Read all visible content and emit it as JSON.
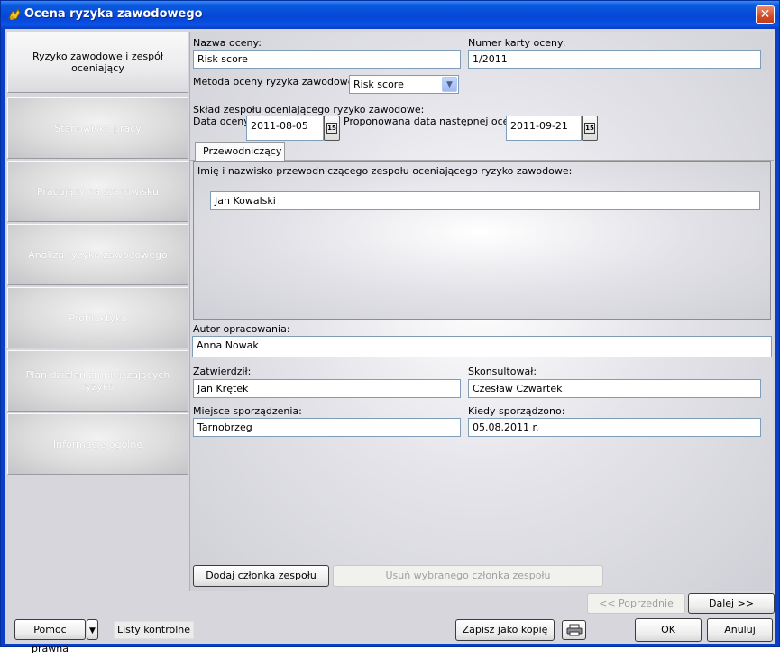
{
  "window": {
    "title": "Ocena ryzyka zawodowego"
  },
  "nav": {
    "items": [
      {
        "label": "Ryzyko zawodowe i zespół oceniający"
      },
      {
        "label": "Stanowisko pracy"
      },
      {
        "label": "Pracujący na stanowisku"
      },
      {
        "label": "Analiza ryzyka zawodowego"
      },
      {
        "label": "Profilaktyka"
      },
      {
        "label": "Plan działań zmniejszających ryzyko"
      },
      {
        "label": "Informacje ogólne"
      }
    ]
  },
  "form": {
    "assessment_name": {
      "label": "Nazwa oceny:",
      "value": "Risk score"
    },
    "card_number": {
      "label": "Numer karty oceny:",
      "value": "1/2011"
    },
    "method": {
      "label": "Metoda oceny ryzyka zawodowego:",
      "value": "Risk score"
    },
    "team_label": "Skład zespołu oceniającego ryzyko zawodowe:",
    "assessment_date": {
      "label": "Data oceny:",
      "value": "2011-08-05"
    },
    "next_date": {
      "label": "Proponowana data następnej oceny:",
      "value": "2011-09-21"
    },
    "calendar_icon_text": "15",
    "tab": {
      "label": "Przewodniczący"
    },
    "chairman": {
      "label": "Imię i nazwisko przewodniczącego zespołu oceniającego ryzyko zawodowe:",
      "value": "Jan Kowalski"
    },
    "author": {
      "label": "Autor opracowania:",
      "value": "Anna Nowak"
    },
    "approved": {
      "label": "Zatwierdził:",
      "value": "Jan Krętek"
    },
    "consulted": {
      "label": "Skonsultował:",
      "value": "Czesław Czwartek"
    },
    "place": {
      "label": "Miejsce sporządzenia:",
      "value": "Tarnobrzeg"
    },
    "when": {
      "label": "Kiedy sporządzono:",
      "value": "05.08.2011 r."
    },
    "add_member": "Dodaj członka zespołu",
    "remove_member": "Usuń wybranego członka zespołu"
  },
  "footer": {
    "prev": "<< Poprzednie",
    "next": "Dalej >>",
    "legal_help": "Pomoc prawna",
    "checklists": "Listy kontrolne",
    "save_copy": "Zapisz jako kopię",
    "ok": "OK",
    "cancel": "Anuluj"
  }
}
